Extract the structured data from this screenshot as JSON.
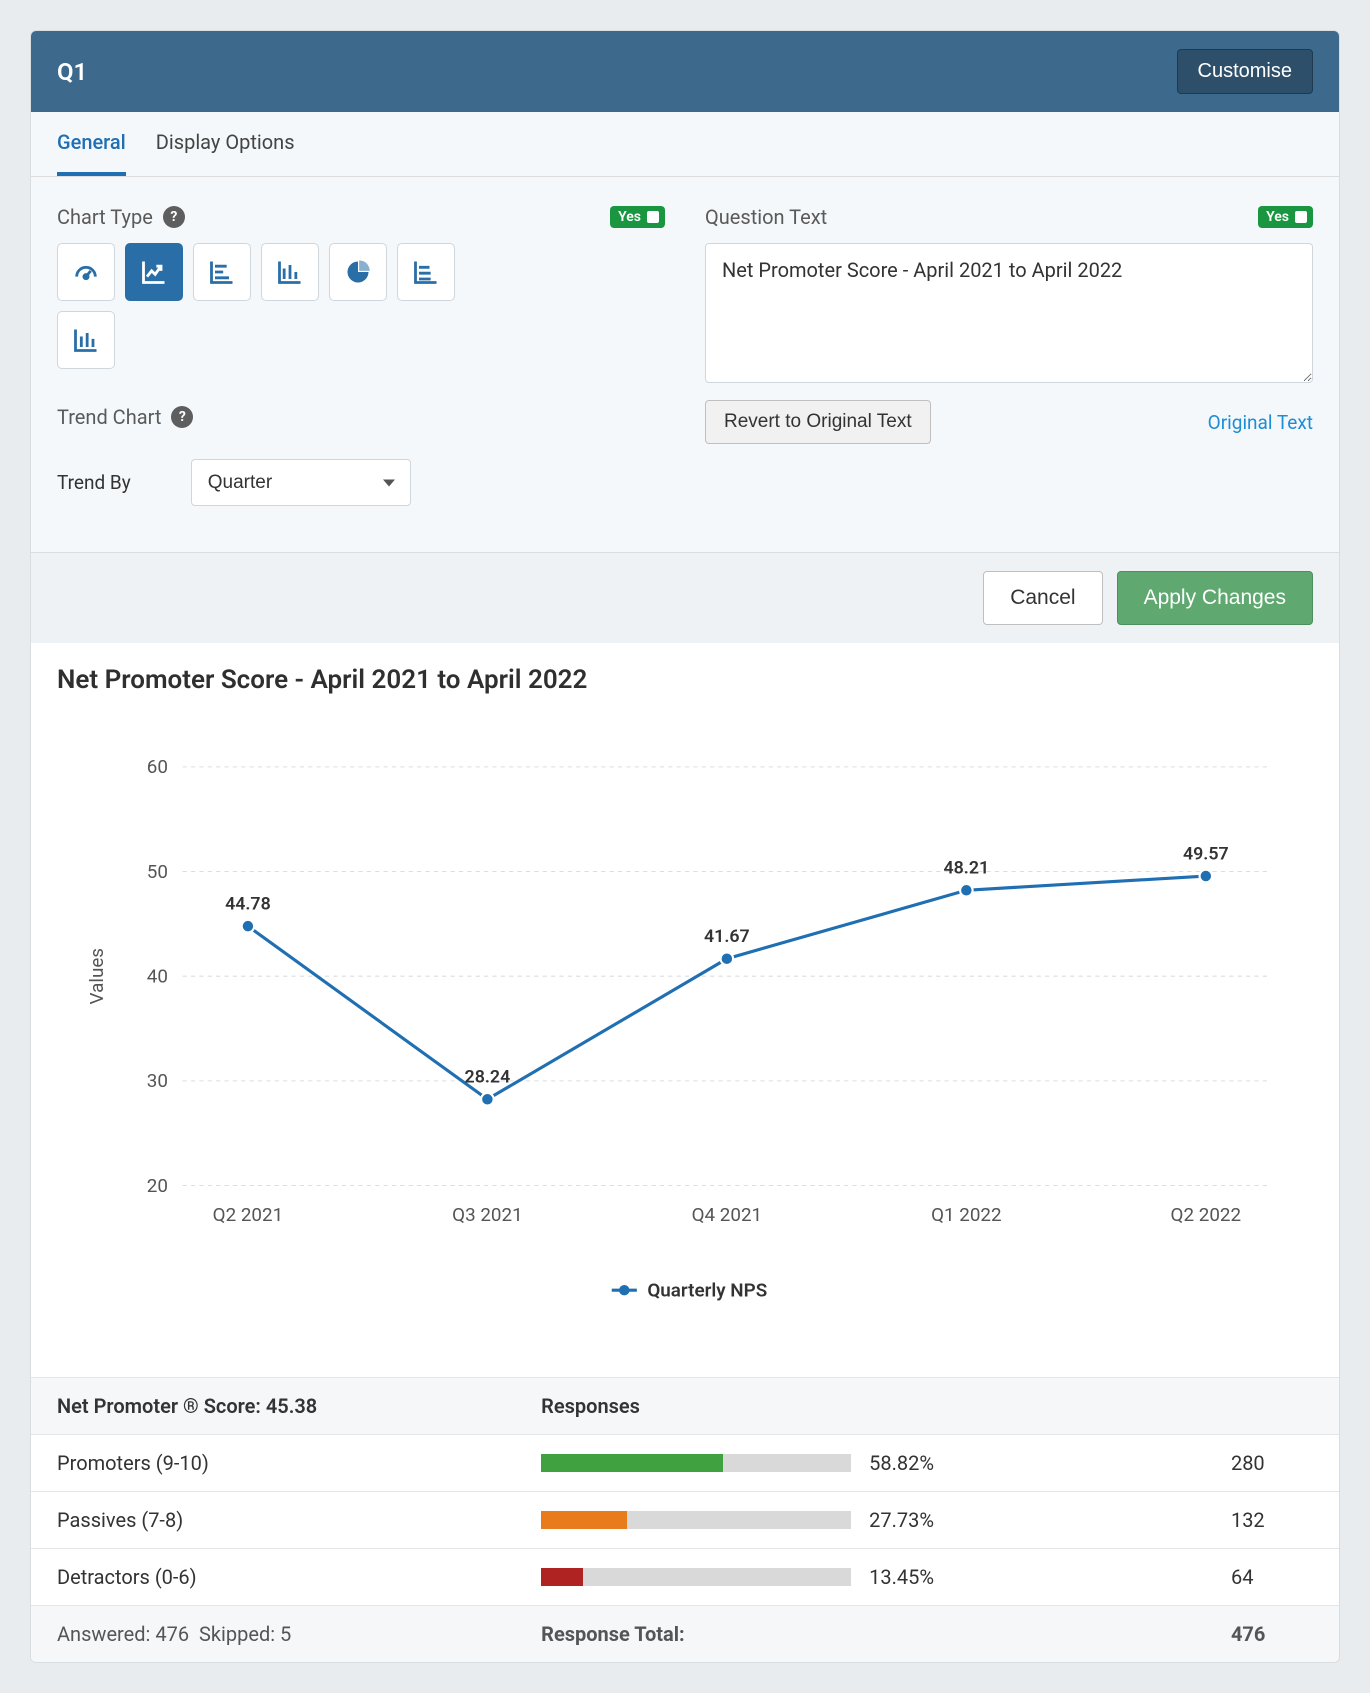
{
  "header": {
    "title": "Q1",
    "customise": "Customise"
  },
  "tabs": {
    "general": "General",
    "display": "Display Options"
  },
  "chartType": {
    "label": "Chart Type",
    "toggle": "Yes"
  },
  "trend": {
    "label": "Trend Chart",
    "trendByLabel": "Trend By",
    "trendByValue": "Quarter"
  },
  "question": {
    "label": "Question Text",
    "toggle": "Yes",
    "text": "Net Promoter Score - April 2021 to April 2022",
    "revert": "Revert to Original Text",
    "originalLink": "Original Text"
  },
  "actions": {
    "cancel": "Cancel",
    "apply": "Apply Changes"
  },
  "chartTitle": "Net Promoter Score - April 2021 to April 2022",
  "chart_data": {
    "type": "line",
    "title": "Net Promoter Score - April 2021 to April 2022",
    "ylabel": "Values",
    "ylim": [
      20,
      60
    ],
    "yticks": [
      20,
      30,
      40,
      50,
      60
    ],
    "categories": [
      "Q2 2021",
      "Q3 2021",
      "Q4 2021",
      "Q1 2022",
      "Q2 2022"
    ],
    "series": [
      {
        "name": "Quarterly NPS",
        "values": [
          44.78,
          28.24,
          41.67,
          48.21,
          49.57
        ],
        "color": "#1f6fb2"
      }
    ]
  },
  "tableHead": {
    "score": "Net Promoter ® Score: 45.38",
    "responses": "Responses"
  },
  "rows": [
    {
      "label": "Promoters (9-10)",
      "percent": "58.82%",
      "pctNum": 58.82,
      "count": "280",
      "color": "#3fa13f"
    },
    {
      "label": "Passives (7-8)",
      "percent": "27.73%",
      "pctNum": 27.73,
      "count": "132",
      "color": "#e87b1c"
    },
    {
      "label": "Detractors (0-6)",
      "percent": "13.45%",
      "pctNum": 13.45,
      "count": "64",
      "color": "#b02323"
    }
  ],
  "footer": {
    "answeredLabel": "Answered:",
    "answered": "476",
    "skippedLabel": "Skipped:",
    "skipped": "5",
    "totalLabel": "Response Total:",
    "total": "476"
  }
}
